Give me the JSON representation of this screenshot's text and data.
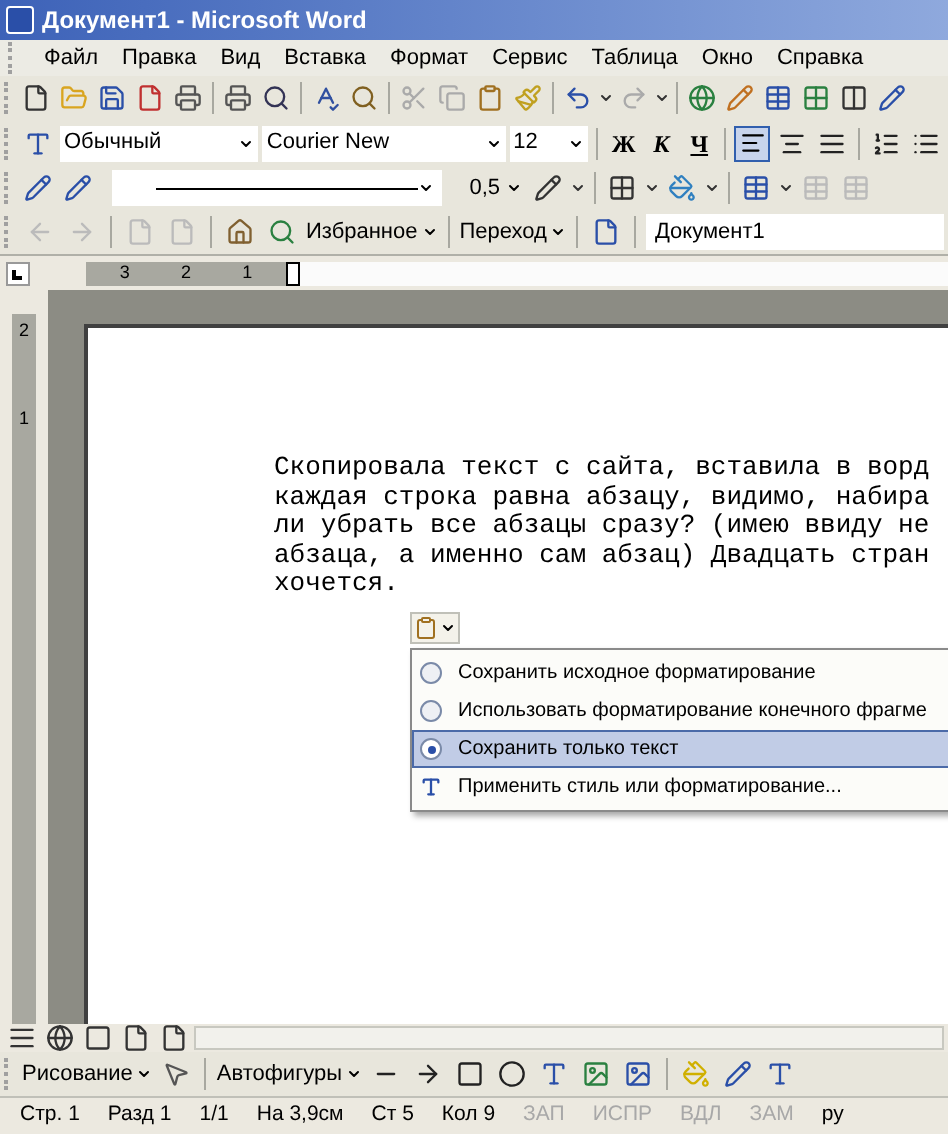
{
  "window": {
    "title": "Документ1 - Microsoft Word"
  },
  "menu": [
    "Файл",
    "Правка",
    "Вид",
    "Вставка",
    "Формат",
    "Сервис",
    "Таблица",
    "Окно",
    "Справка"
  ],
  "formatting": {
    "style": "Обычный",
    "font": "Courier New",
    "size": "12",
    "bold": "Ж",
    "italic": "К",
    "underline": "Ч"
  },
  "tables_toolbar": {
    "line_weight": "0,5"
  },
  "web_toolbar": {
    "favorites": "Избранное",
    "go": "Переход",
    "address": "Документ1"
  },
  "ruler": {
    "horizontal": [
      "3",
      "2",
      "1"
    ],
    "vertical": [
      "2",
      "1"
    ]
  },
  "document": {
    "lines": [
      "Скопировала текст с сайта, вставила в ворд",
      "каждая строка равна абзацу, видимо, набира",
      "ли убрать все абзацы сразу? (имею ввиду не",
      "абзаца, а именно сам абзац) Двадцать стран",
      "хочется."
    ]
  },
  "paste_menu": [
    {
      "kind": "radio",
      "label": "Сохранить исходное форматирование",
      "selected": false
    },
    {
      "kind": "radio",
      "label": "Использовать форматирование конечного фрагме",
      "selected": false
    },
    {
      "kind": "radio",
      "label": "Сохранить только текст",
      "selected": true
    },
    {
      "kind": "style",
      "label": "Применить стиль или форматирование...",
      "selected": false
    }
  ],
  "drawing_toolbar": {
    "drawing": "Рисование",
    "autoshapes": "Автофигуры"
  },
  "status_bar": [
    {
      "text": "Стр. 1",
      "disabled": false
    },
    {
      "text": "Разд 1",
      "disabled": false
    },
    {
      "text": "1/1",
      "disabled": false
    },
    {
      "text": "На 3,9см",
      "disabled": false
    },
    {
      "text": "Ст 5",
      "disabled": false
    },
    {
      "text": "Кол 9",
      "disabled": false
    },
    {
      "text": "ЗАП",
      "disabled": true
    },
    {
      "text": "ИСПР",
      "disabled": true
    },
    {
      "text": "ВДЛ",
      "disabled": true
    },
    {
      "text": "ЗАМ",
      "disabled": true
    },
    {
      "text": "ру",
      "disabled": false
    }
  ]
}
